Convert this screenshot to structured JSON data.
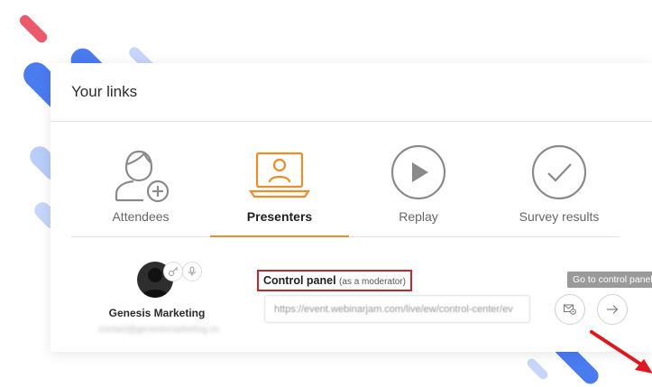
{
  "card": {
    "title": "Your links"
  },
  "tabs": [
    {
      "id": "attendees",
      "label": "Attendees",
      "icon": "user-add-icon",
      "active": false
    },
    {
      "id": "presenters",
      "label": "Presenters",
      "icon": "presenter-laptop-icon",
      "active": true
    },
    {
      "id": "replay",
      "label": "Replay",
      "icon": "play-icon",
      "active": false
    },
    {
      "id": "survey",
      "label": "Survey results",
      "icon": "check-circle-icon",
      "active": false
    }
  ],
  "presenter": {
    "name": "Genesis Marketing",
    "email": "contact@genesismarketing.co",
    "icons": [
      "key-icon",
      "microphone-icon"
    ]
  },
  "control_panel": {
    "label": "Control panel",
    "sub_label": "(as a moderator)",
    "url": "https://event.webinarjam.com/live/ew/control-center/ev"
  },
  "actions": {
    "tooltip": "Go to control panel",
    "email_icon": "email-settings-icon",
    "go_icon": "arrow-right-icon"
  },
  "colors": {
    "accent": "#ee8c2a",
    "highlight": "#c0282c",
    "decor_blue": "#4a7cf0",
    "decor_red": "#ea5a6a"
  }
}
